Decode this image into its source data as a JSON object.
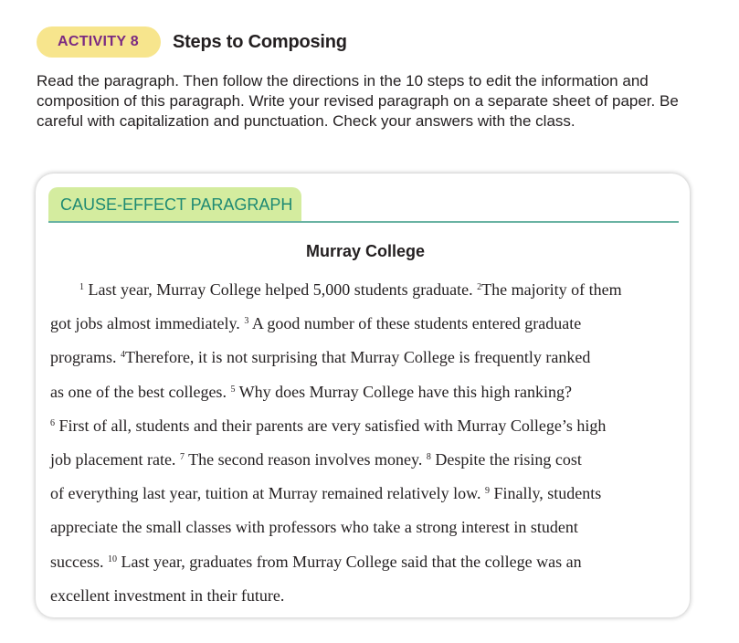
{
  "activity": {
    "badge": "ACTIVITY 8",
    "title": "Steps to Composing"
  },
  "instructions": "Read the paragraph. Then follow the directions in the 10 steps to edit the information and composition of this paragraph. Write your revised paragraph on a separate sheet of paper. Be careful with capitalization and punctuation. Check your answers with the class.",
  "card": {
    "tab_label": "CAUSE-EFFECT PARAGRAPH",
    "paragraph_title": "Murray College",
    "lines": [
      [
        {
          "n": "1",
          "t": " Last year, Murray College helped 5,000 students graduate. "
        },
        {
          "n": "2",
          "t": "The majority of them"
        }
      ],
      [
        {
          "n": "",
          "t": "got jobs almost immediately. "
        },
        {
          "n": "3",
          "t": " A good number of these students entered graduate"
        }
      ],
      [
        {
          "n": "",
          "t": "programs. "
        },
        {
          "n": "4",
          "t": "Therefore, it is not surprising that Murray College is frequently ranked"
        }
      ],
      [
        {
          "n": "",
          "t": "as one of the best colleges. "
        },
        {
          "n": "5",
          "t": " Why does Murray College have this high ranking?"
        }
      ],
      [
        {
          "n": "6",
          "t": " First of all, students and their parents are very satisfied with Murray College’s high"
        }
      ],
      [
        {
          "n": "",
          "t": "job placement rate. "
        },
        {
          "n": "7",
          "t": " The second reason involves money. "
        },
        {
          "n": "8",
          "t": " Despite the rising cost"
        }
      ],
      [
        {
          "n": "",
          "t": "of everything last year, tuition at Murray remained relatively low. "
        },
        {
          "n": "9",
          "t": " Finally, students"
        }
      ],
      [
        {
          "n": "",
          "t": "appreciate the small classes with professors who take a strong interest in student"
        }
      ],
      [
        {
          "n": "",
          "t": "success. "
        },
        {
          "n": "10",
          "t": " Last year, graduates from Murray College said that the college was an"
        }
      ],
      [
        {
          "n": "",
          "t": "excellent investment in their future."
        }
      ]
    ]
  },
  "colors": {
    "badge_bg": "#f7e58d",
    "badge_text": "#7b2a82",
    "tab_bg": "#d4ec9f",
    "tab_text": "#1e8a73",
    "rule": "#6ab3a3"
  }
}
